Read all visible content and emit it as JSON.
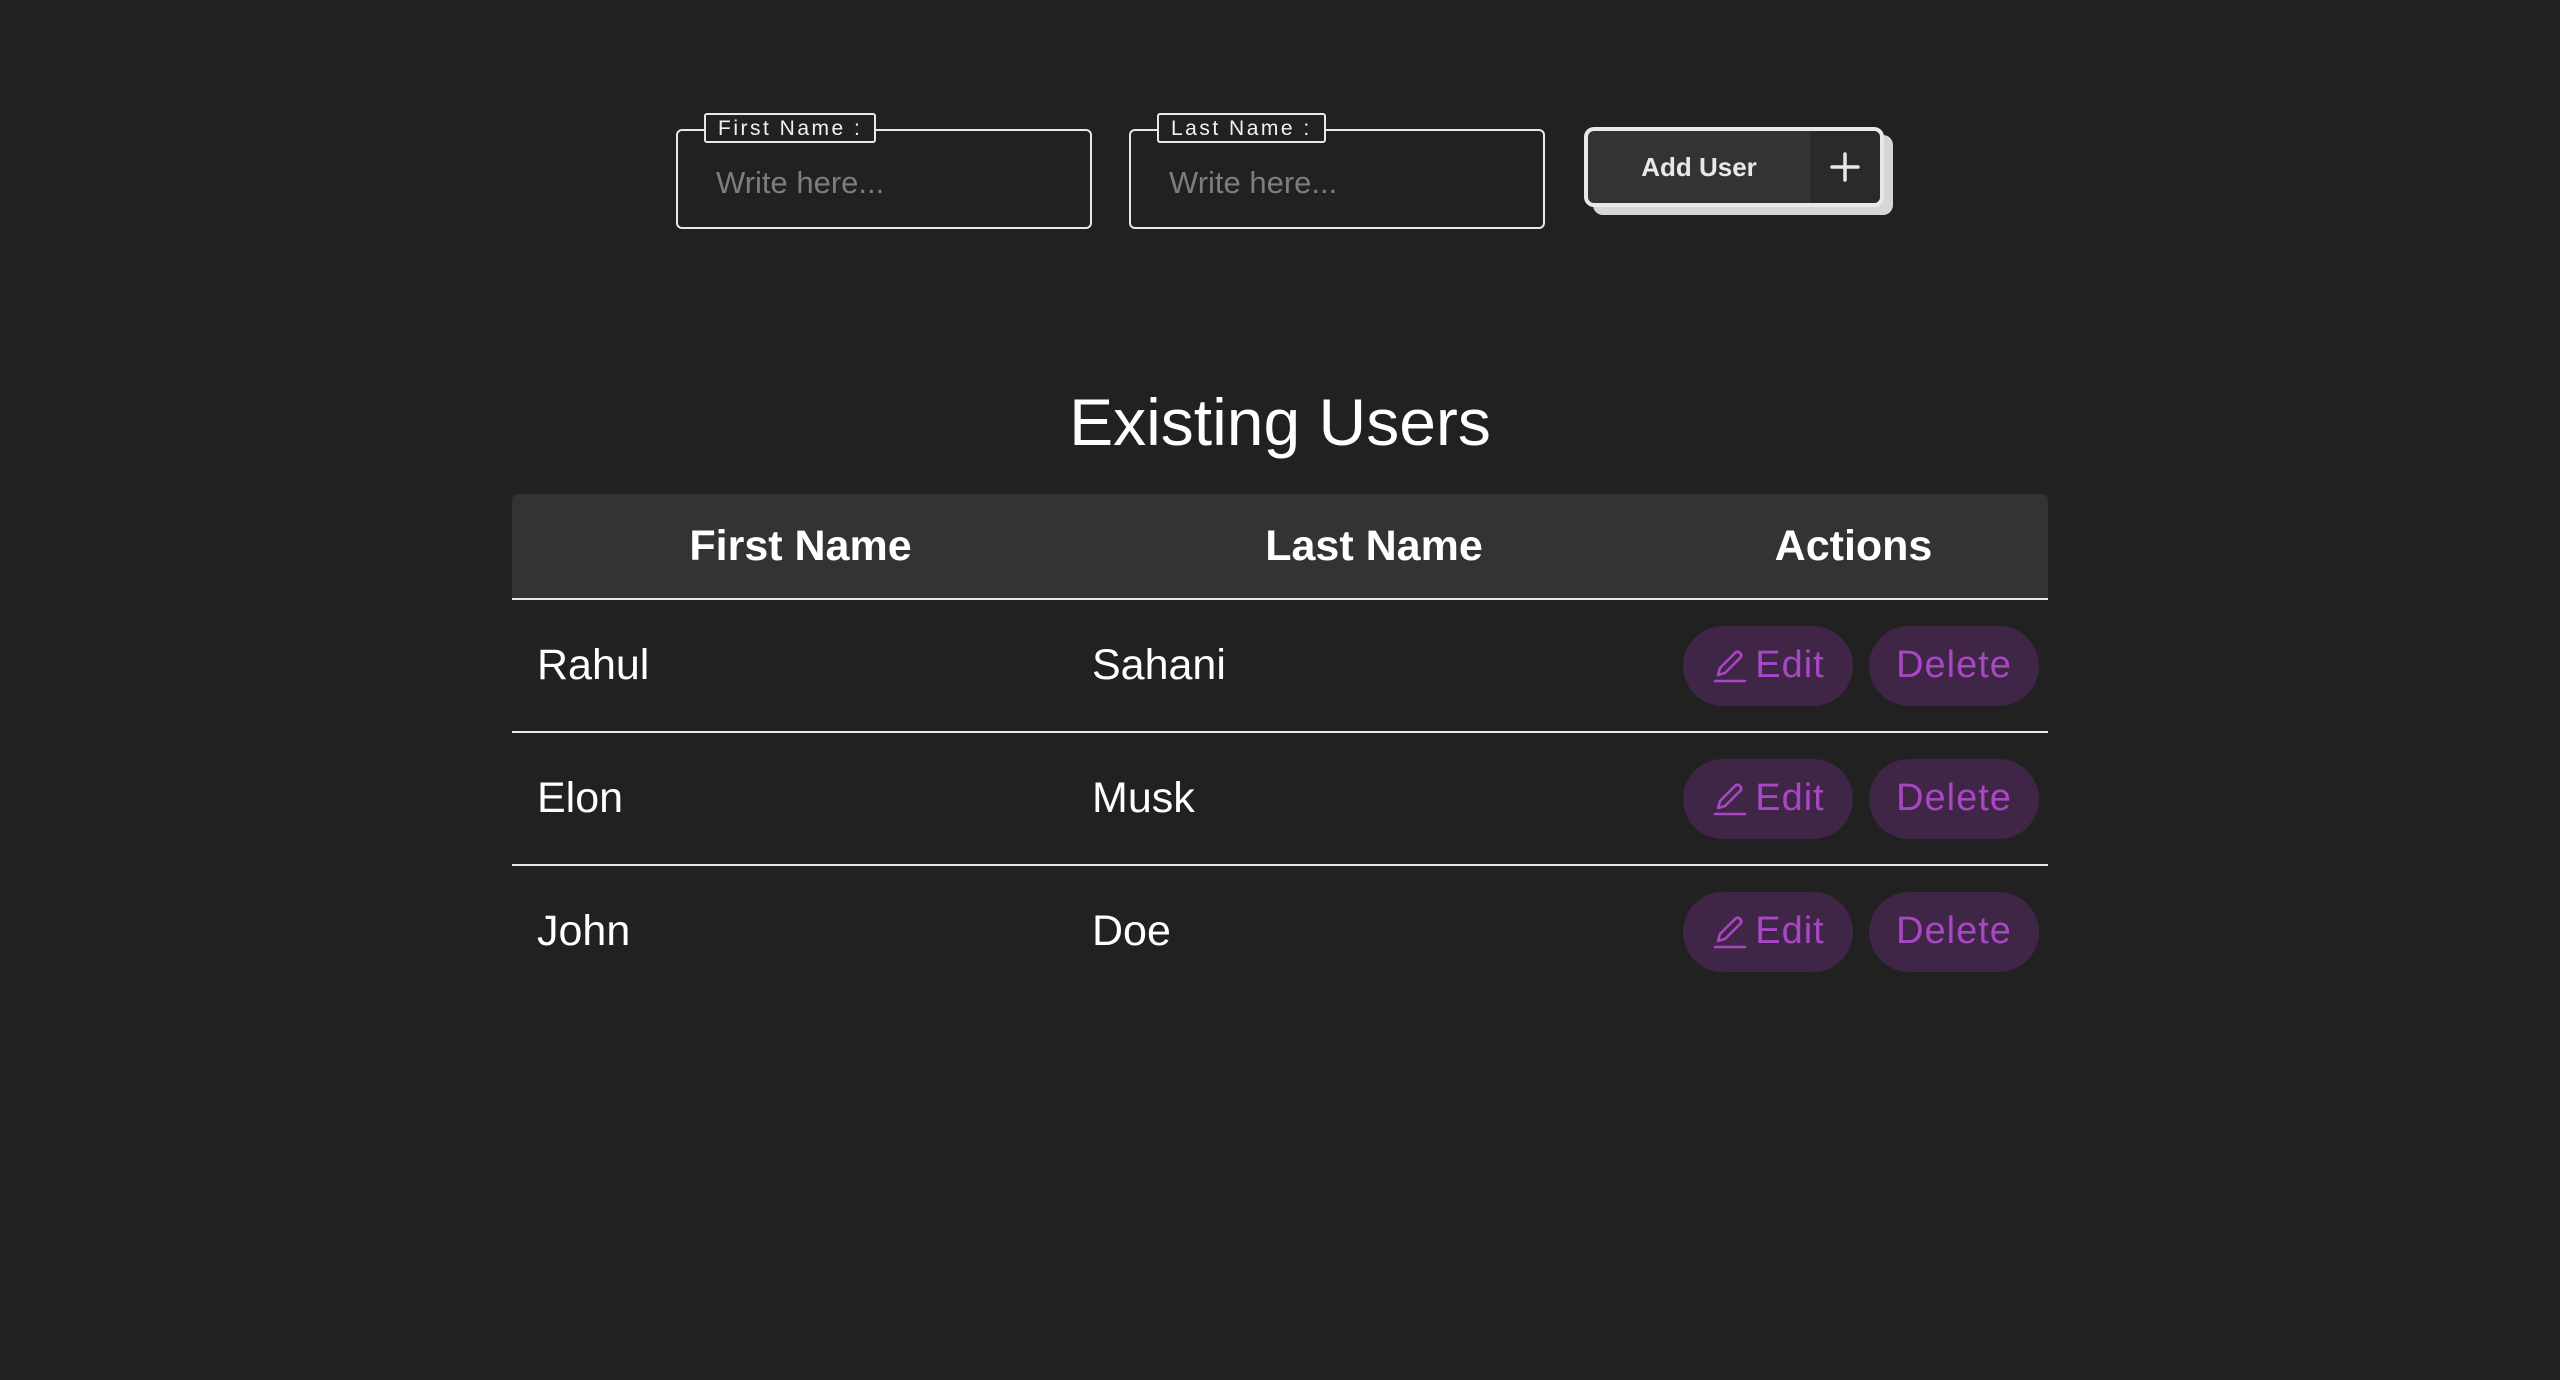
{
  "form": {
    "first_name": {
      "label": "First Name :",
      "placeholder": "Write here...",
      "value": ""
    },
    "last_name": {
      "label": "Last Name :",
      "placeholder": "Write here...",
      "value": ""
    },
    "add_button": {
      "label": "Add User",
      "icon": "plus-icon"
    }
  },
  "users_section": {
    "title": "Existing Users",
    "columns": [
      "First Name",
      "Last Name",
      "Actions"
    ],
    "rows": [
      {
        "first_name": "Rahul",
        "last_name": "Sahani",
        "edit_label": "Edit",
        "delete_label": "Delete"
      },
      {
        "first_name": "Elon",
        "last_name": "Musk",
        "edit_label": "Edit",
        "delete_label": "Delete"
      },
      {
        "first_name": "John",
        "last_name": "Doe",
        "edit_label": "Edit",
        "delete_label": "Delete"
      }
    ]
  },
  "colors": {
    "background": "#212121",
    "header_background": "#333333",
    "accent": "#a946c6",
    "accent_background": "#3f2546",
    "border": "#e8e8e8"
  }
}
